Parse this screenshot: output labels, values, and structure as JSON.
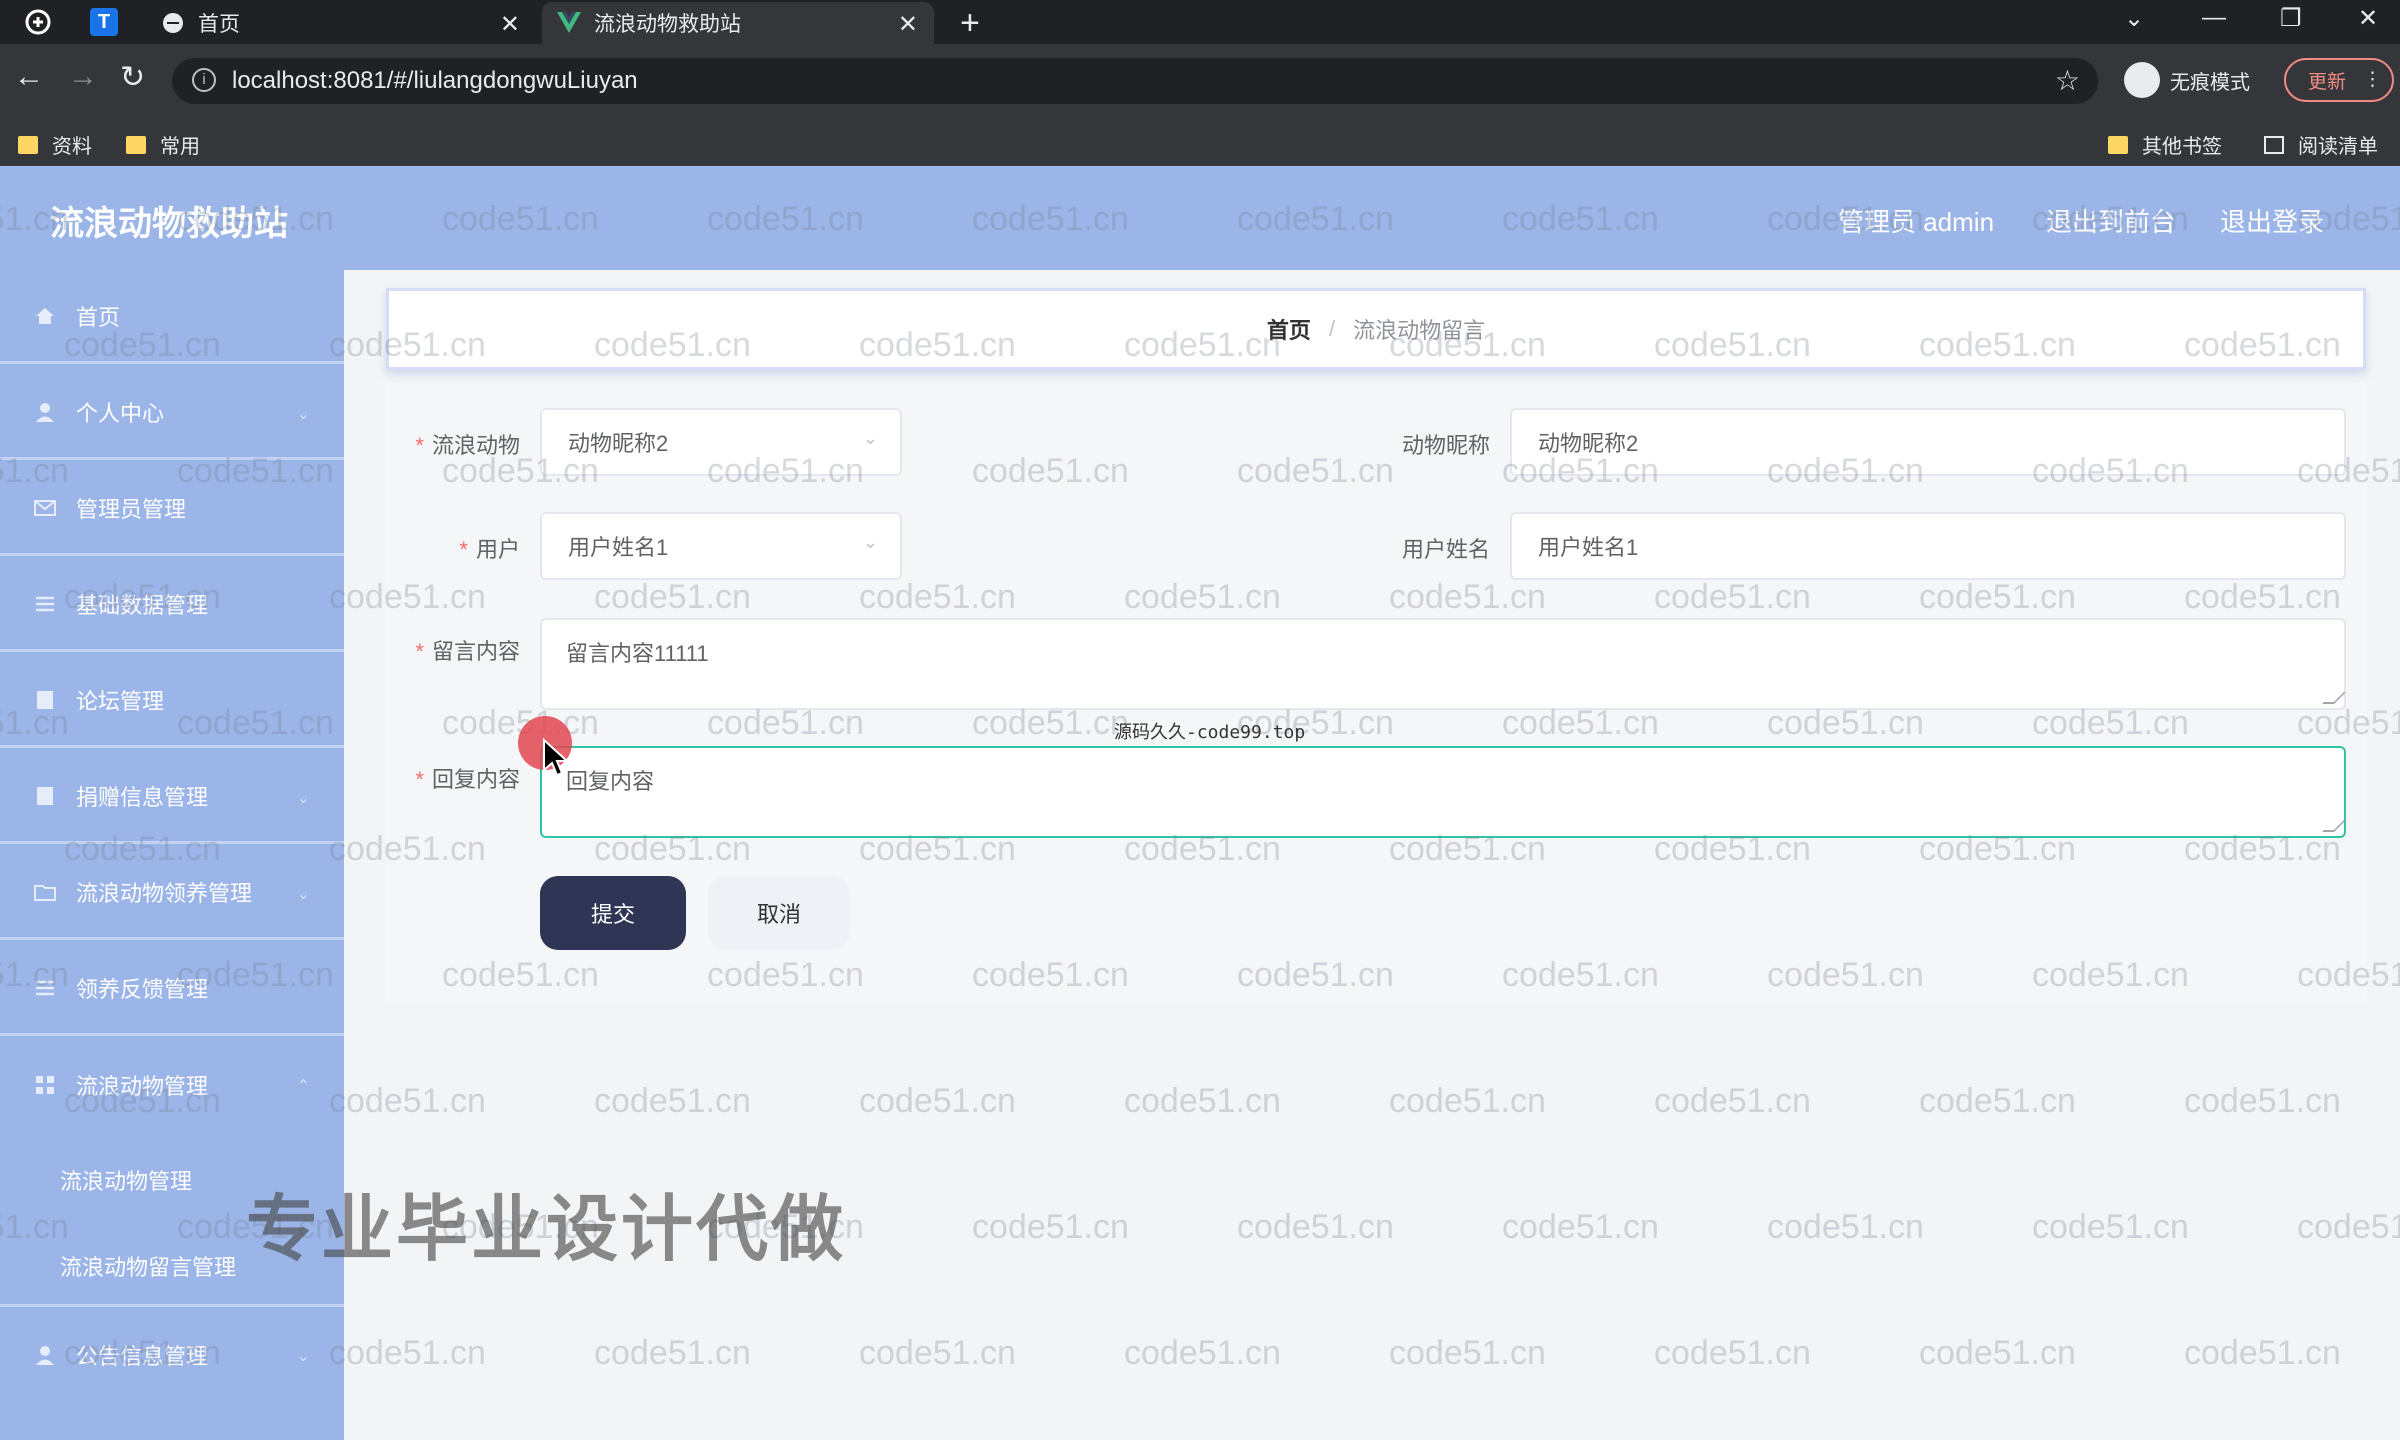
{
  "browser": {
    "tabs": [
      {
        "title": "首页",
        "active": false
      },
      {
        "title": "流浪动物救助站",
        "active": true
      }
    ],
    "url": "localhost:8081/#/liulangdongwuLiuyan",
    "incognito_label": "无痕模式",
    "update_label": "更新",
    "bookmarks": [
      "资料",
      "常用"
    ],
    "bookmarks_right": [
      "其他书签",
      "阅读清单"
    ]
  },
  "header": {
    "title": "流浪动物救助站",
    "admin_label": "管理员 admin",
    "back_label": "退出到前台",
    "logout_label": "退出登录"
  },
  "sidebar": {
    "items": [
      {
        "label": "首页",
        "icon": "home-icon"
      },
      {
        "label": "个人中心",
        "icon": "user-icon"
      },
      {
        "label": "管理员管理",
        "icon": "mail-icon"
      },
      {
        "label": "基础数据管理",
        "icon": "list-icon"
      },
      {
        "label": "论坛管理",
        "icon": "doc-icon"
      },
      {
        "label": "捐赠信息管理",
        "icon": "doc-icon"
      },
      {
        "label": "流浪动物领养管理",
        "icon": "folder-icon"
      },
      {
        "label": "领养反馈管理",
        "icon": "list-icon"
      },
      {
        "label": "流浪动物管理",
        "icon": "grid-icon"
      },
      {
        "label": "公告信息管理",
        "icon": "user-icon"
      }
    ],
    "submenu": [
      "流浪动物管理",
      "流浪动物留言管理"
    ]
  },
  "breadcrumb": {
    "home": "首页",
    "separator": "/",
    "current": "流浪动物留言"
  },
  "form": {
    "animal_label": "流浪动物",
    "animal_value": "动物昵称2",
    "animal_nick_label": "动物昵称",
    "animal_nick_value": "动物昵称2",
    "user_label": "用户",
    "user_value": "用户姓名1",
    "user_name_label": "用户姓名",
    "user_name_value": "用户姓名1",
    "message_label": "留言内容",
    "message_value": "留言内容11111",
    "reply_label": "回复内容",
    "reply_placeholder": "回复内容",
    "submit_label": "提交",
    "cancel_label": "取消"
  },
  "watermark": {
    "text": "code51.cn",
    "mid_text": "源码久久-code99.top",
    "big_text": "专业毕业设计代做"
  },
  "colors": {
    "header_bg": "#9bb5e8",
    "submit_bg": "#2f3554",
    "required": "#f56c6c",
    "focus_border": "#2ec4a5"
  }
}
